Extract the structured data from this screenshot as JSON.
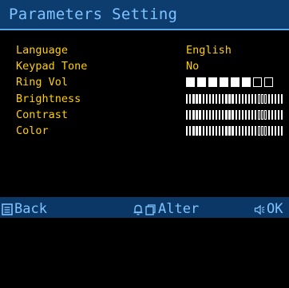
{
  "header": {
    "title": "Parameters Setting"
  },
  "settings": {
    "language": {
      "label": "Language",
      "value": "English"
    },
    "keypad_tone": {
      "label": "Keypad Tone",
      "value": "No"
    },
    "ring_vol": {
      "label": "Ring Vol",
      "level": 6,
      "max": 8
    },
    "brightness": {
      "label": "Brightness",
      "level": 15,
      "max": 30
    },
    "contrast": {
      "label": "Contrast",
      "level": 15,
      "max": 30
    },
    "color": {
      "label": "Color",
      "level": 15,
      "max": 30
    }
  },
  "footer": {
    "back_label": "Back",
    "alter_label": "Alter",
    "ok_label": "OK"
  },
  "colors": {
    "text": "#ffd000",
    "title": "#7fc3ff",
    "header_bg": "#0d3c6e",
    "filled": "#ffffff",
    "empty_outline": "#ffffff"
  },
  "icons": {
    "back": "list-icon",
    "alter": "bell-and-page-icon",
    "ok": "speaker-icon"
  }
}
